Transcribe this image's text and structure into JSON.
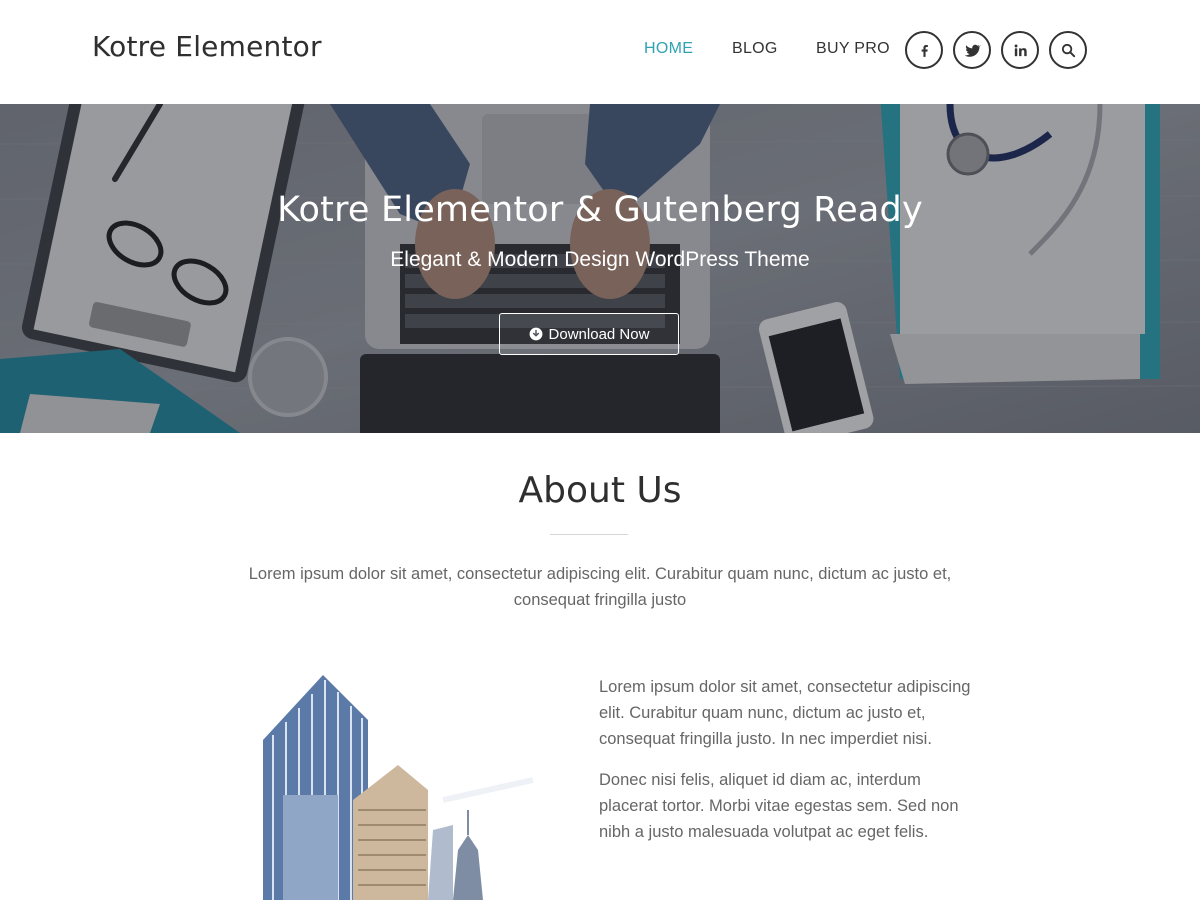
{
  "header": {
    "brand": "Kotre Elementor",
    "nav": [
      {
        "label": "HOME",
        "active": true
      },
      {
        "label": "BLOG",
        "active": false
      },
      {
        "label": "BUY PRO",
        "active": false
      }
    ],
    "social_icons": [
      "facebook-icon",
      "twitter-icon",
      "linkedin-icon",
      "search-icon"
    ]
  },
  "hero": {
    "title": "Kotre Elementor & Gutenberg Ready",
    "subtitle": "Elegant & Modern Design WordPress Theme",
    "button_label": "Download Now",
    "button_icon": "download-circle-icon"
  },
  "about": {
    "title": "About Us",
    "intro": "Lorem ipsum dolor sit amet, consectetur adipiscing elit. Curabitur quam nunc, dictum ac justo et, consequat fringilla justo",
    "paragraph_1": "Lorem ipsum dolor sit amet, consectetur adipiscing elit. Curabitur quam nunc, dictum ac justo et, consequat fringilla justo. In nec imperdiet nisi.",
    "paragraph_2": "Donec nisi felis, aliquet id diam ac, interdum placerat tortor. Morbi vitae egestas sem. Sed non nibh a justo malesuada volutpat ac eget felis."
  },
  "colors": {
    "accent": "#2fa3b0",
    "text_dark": "#2f2f2f",
    "text_body": "#666666",
    "teal_paper": "#2aa5b8"
  }
}
